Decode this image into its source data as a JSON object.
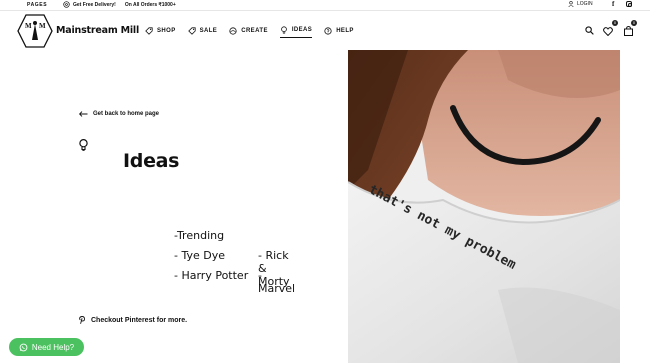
{
  "topbar": {
    "pages_label": "PAGES",
    "delivery_text": "Get Free Delivery!",
    "delivery_orders": "On All Orders ₹1000+",
    "login_label": "LOGIN"
  },
  "header": {
    "brand": "Mainstream Mill",
    "logo_letters": "M M",
    "nav": [
      {
        "label": "SHOP",
        "icon": "tag-icon"
      },
      {
        "label": "SALE",
        "icon": "tag-icon"
      },
      {
        "label": "CREATE",
        "icon": "palette-icon"
      },
      {
        "label": "IDEAS",
        "icon": "bulb-icon",
        "active": true
      },
      {
        "label": "HELP",
        "icon": "help-icon"
      }
    ],
    "wishlist_count": "0",
    "cart_count": "0"
  },
  "content": {
    "back_link": "Get back to home page",
    "page_title": "Ideas",
    "tags_col1": [
      "-Trending",
      "- Tye Dye",
      "- Harry Potter"
    ],
    "tags_col2": [
      "- Rick & Morty",
      "- Marvel"
    ],
    "pinterest_text": "Checkout Pinterest for more."
  },
  "help_button": {
    "label": "Need Help?"
  },
  "hero": {
    "shirt_text": "that's not my problem"
  },
  "colors": {
    "help_green": "#4bc25f",
    "text": "#111111"
  }
}
